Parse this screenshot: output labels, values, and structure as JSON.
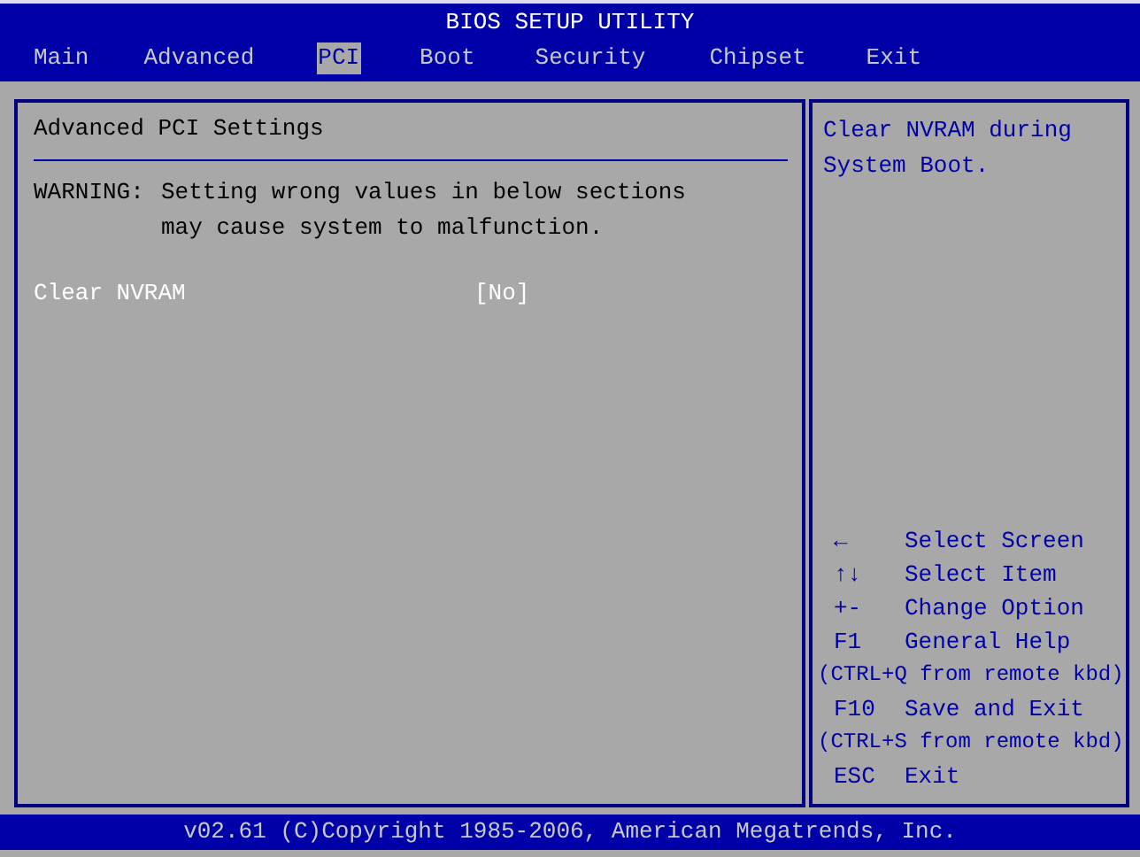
{
  "window": {
    "title": "BIOS SETUP UTILITY"
  },
  "tabs": [
    {
      "label": "Main",
      "selected": false
    },
    {
      "label": "Advanced",
      "selected": false
    },
    {
      "label": "PCI",
      "selected": true
    },
    {
      "label": "Boot",
      "selected": false
    },
    {
      "label": "Security",
      "selected": false
    },
    {
      "label": "Chipset",
      "selected": false
    },
    {
      "label": "Exit",
      "selected": false
    }
  ],
  "main_panel": {
    "heading": "Advanced PCI Settings",
    "warning_label": "WARNING:",
    "warning_lines": [
      "Setting wrong values in below sections",
      "may cause system to malfunction."
    ],
    "settings": [
      {
        "label": "Clear NVRAM",
        "value": "[No]",
        "selected": true
      }
    ]
  },
  "help_panel": {
    "description_lines": [
      "Clear NVRAM during",
      "System Boot."
    ],
    "keys": [
      {
        "kind": "key",
        "key": "←",
        "action": "Select Screen"
      },
      {
        "kind": "key",
        "key": "↑↓",
        "action": "Select Item"
      },
      {
        "kind": "key",
        "key": "+-",
        "action": "Change Option"
      },
      {
        "kind": "key",
        "key": "F1",
        "action": "General Help"
      },
      {
        "kind": "note",
        "text": "(CTRL+Q from remote kbd)"
      },
      {
        "kind": "key",
        "key": "F10",
        "action": "Save and Exit"
      },
      {
        "kind": "note",
        "text": "(CTRL+S from remote kbd)"
      },
      {
        "kind": "key",
        "key": "ESC",
        "action": "Exit"
      }
    ]
  },
  "status_bar": {
    "text": "v02.61 (C)Copyright 1985-2006, American Megatrends, Inc."
  }
}
